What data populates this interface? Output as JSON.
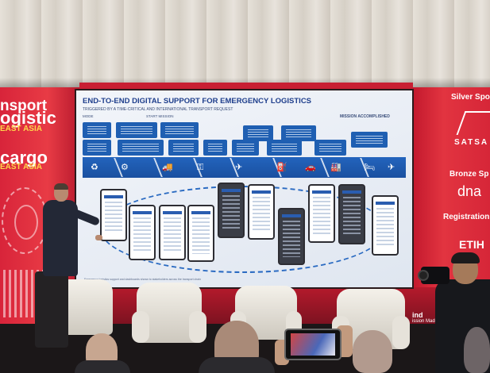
{
  "venue": {
    "left_banner": {
      "line1": "nsport",
      "line2": "ogistic",
      "line3": "EAST ASIA",
      "line4": "cargo",
      "line5": "EAST ASIA"
    },
    "right_banner": {
      "silver": "Silver Spo",
      "satsa": "SATSA",
      "bronze": "Bronze Sp",
      "dnata": "dna",
      "registration": "Registration",
      "etihad": "ETIH",
      "sponsor_bottom": "ind",
      "sponsor_bottom_sub": "ission Made"
    }
  },
  "slide": {
    "title": "END-TO-END DIGITAL SUPPORT FOR EMERGENCY LOGISTICS",
    "subtitle": "TRIGGERED BY A TIME-CRITICAL AND INTERNATIONAL TRANSPORT REQUEST",
    "label_left": "MODE",
    "label_mid": "START MISSION",
    "label_right": "MISSION ACCOMPLISHED",
    "footer": "Emergency logistics support and dashboards shown to stakeholders across the transport chain",
    "flow_icons": [
      "♻",
      "⚙",
      "🚚",
      "⚿",
      "✈",
      "⛽",
      "🚗",
      "🏭",
      "🛏",
      "✈"
    ]
  },
  "colors": {
    "led_red": "#d8243a",
    "slide_blue": "#1e3e8c",
    "band_blue": "#2364bd"
  }
}
